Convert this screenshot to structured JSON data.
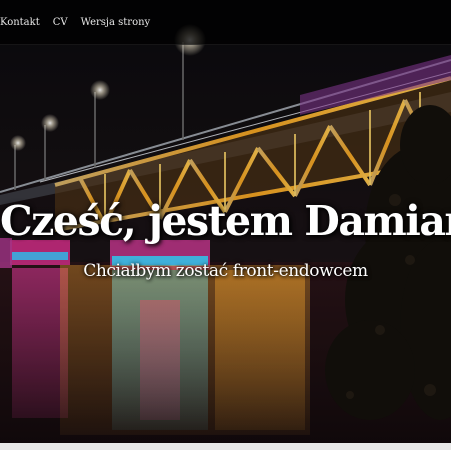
{
  "navbar": {
    "links": [
      {
        "label": "Kontakt"
      },
      {
        "label": "CV"
      },
      {
        "label": "Wersja strony"
      }
    ]
  },
  "hero": {
    "title": "Cześć, jestem Damian",
    "subtitle": "Chciałbym zostać front-endowcem",
    "background_image": "night-bridge-illuminated-photo"
  },
  "colors": {
    "bridge_orange": "#f5a623",
    "bridge_yellow": "#ffd54a",
    "bridge_pink": "#e040a0",
    "bridge_cyan": "#3fd0ff",
    "sky": "#0b0b10",
    "water": "#1a0f12"
  }
}
